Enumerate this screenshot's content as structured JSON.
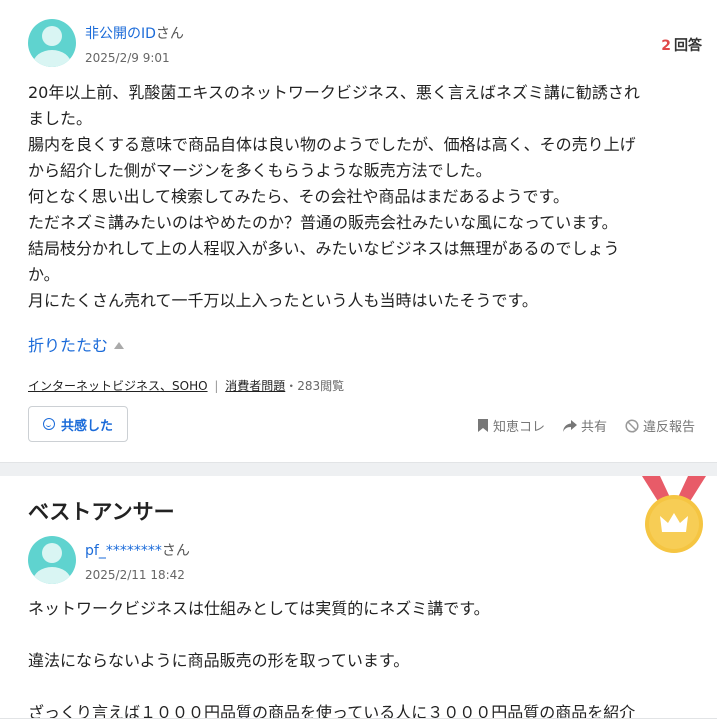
{
  "question": {
    "user_id": "非公開のID",
    "user_suffix": "さん",
    "date": "2025/2/9 9:01",
    "answer_count": "2",
    "answer_label": "回答",
    "lines": [
      "20年以上前、乳酸菌エキスのネットワークビジネス、悪く言えばネズミ講に勧誘されました。",
      "ました。",
      "腸内を良くする意味で商品自体は良い物のようでしたが、価格は高く、その売り上げ",
      "から紹介した側がマージンを多くもらうような販売方法でした。",
      "何となく思い出して検索してみたら、その会社や商品はまだあるようです。",
      "ただネズミ講みたいのはやめたのか？普通の販売会社みたいな風になっています。",
      "結局枝分かれして上の人程収入が多い、みたいなビジネスは無理があるのでしょう",
      "か。",
      "月にたくさん売れて一千万以上入ったという人も当時はいたそうです。"
    ],
    "fold_label": "折りたたむ",
    "category_1": "インターネットビジネス、SOHO",
    "category_sep": "|",
    "category_2": "消費者問題",
    "views": "・283閲覧",
    "like_label": "共感した",
    "actions": {
      "bookmark": "知恵コレ",
      "share": "共有",
      "report": "違反報告"
    }
  },
  "best_answer": {
    "title": "ベストアンサー",
    "user_id": "pf_********",
    "user_suffix": "さん",
    "date": "2025/2/11 18:42",
    "lines": [
      "ネットワークビジネスは仕組みとしては実質的にネズミ講です。",
      "",
      "違法にならないように商品販売の形を取っています。",
      "",
      "ざっくり言えば１０００円品質の商品を使っている人に３０００円品質の商品を紹介"
    ]
  },
  "colors": {
    "accent_link": "#1b6bd9",
    "answer_count": "#e04848",
    "avatar": "#5fd3cf",
    "medal_gold": "#f5c542",
    "medal_ribbon": "#e85b68"
  }
}
